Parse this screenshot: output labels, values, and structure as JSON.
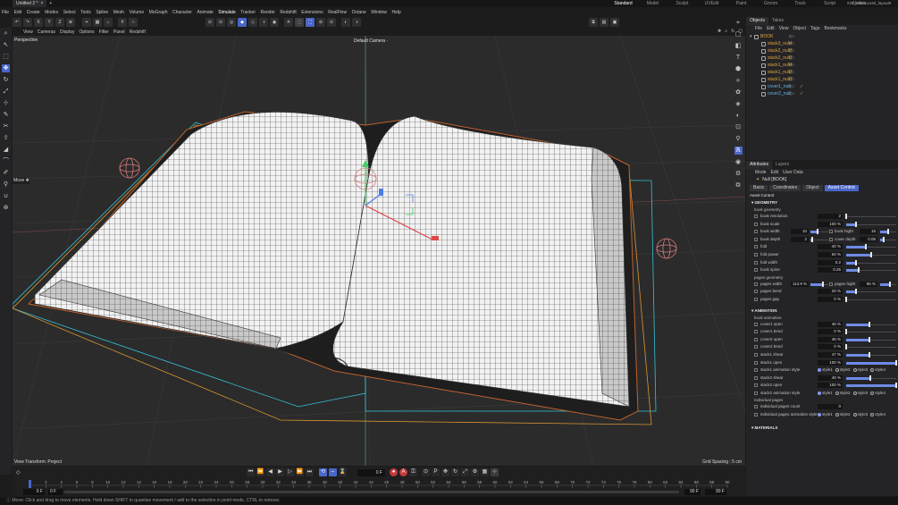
{
  "tabs": {
    "document": "Untitled 2 *",
    "layouts": [
      "Standard",
      "Model",
      "Sculpt",
      "UVEdit",
      "Paint",
      "Groom",
      "Track",
      "Script",
      "Nodes"
    ],
    "project": "#28_2560x1440_layout0"
  },
  "menu": [
    "File",
    "Edit",
    "Create",
    "Modes",
    "Select",
    "Tools",
    "Spline",
    "Mesh",
    "Volume",
    "MoGraph",
    "Character",
    "Animate",
    "Simulate",
    "Tracker",
    "Render",
    "Redshift",
    "Extensions",
    "RealFlow",
    "Octane",
    "Window",
    "Help"
  ],
  "toolbar": {
    "axis": [
      "X",
      "Y",
      "Z"
    ]
  },
  "viewport": {
    "menu": [
      "View",
      "Cameras",
      "Display",
      "Options",
      "Filter",
      "Panel",
      "Redshift"
    ],
    "label": "Perspective",
    "camera": "Default Camera",
    "camera_icon": "dot-icon",
    "transform": "View Transform: Project",
    "grid": "Grid Spacing : 5 cm",
    "tooltip": "Move"
  },
  "timeline": {
    "frame": "0 F",
    "start": "0 F",
    "start2": "0 F",
    "end": "90 F",
    "end2": "90 F",
    "ticks": [
      "0",
      "2",
      "4",
      "6",
      "8",
      "10",
      "12",
      "14",
      "16",
      "18",
      "20",
      "22",
      "24",
      "26",
      "28",
      "30",
      "32",
      "34",
      "36",
      "38",
      "40",
      "42",
      "44",
      "46",
      "48",
      "50",
      "52",
      "54",
      "56",
      "58",
      "60",
      "62",
      "64",
      "66",
      "68",
      "70",
      "72",
      "74",
      "76",
      "78",
      "80",
      "82",
      "84",
      "86",
      "88",
      "90"
    ]
  },
  "status": "Move: Click and drag to move elements. Hold down SHIFT to quantize movement / add to the selection in point mode, CTRL to remove.",
  "objects": {
    "tabs": [
      "Objects",
      "Takes"
    ],
    "menu": [
      "File",
      "Edit",
      "View",
      "Object",
      "Tags",
      "Bookmarks"
    ],
    "items": [
      {
        "name": "BOOK",
        "indent": 0,
        "cyan": false,
        "check": false
      },
      {
        "name": "stack3_null4",
        "indent": 1,
        "cyan": false,
        "check": false
      },
      {
        "name": "stack2_null3",
        "indent": 1,
        "cyan": false,
        "check": false
      },
      {
        "name": "stack2_null2",
        "indent": 1,
        "cyan": false,
        "check": false
      },
      {
        "name": "stack1_null4",
        "indent": 1,
        "cyan": false,
        "check": false
      },
      {
        "name": "stack1_null3",
        "indent": 1,
        "cyan": false,
        "check": false
      },
      {
        "name": "stack1_null2",
        "indent": 1,
        "cyan": false,
        "check": false
      },
      {
        "name": "cover1_null",
        "indent": 1,
        "cyan": true,
        "check": true
      },
      {
        "name": "cover2_null",
        "indent": 1,
        "cyan": true,
        "check": true
      }
    ]
  },
  "attributes": {
    "tabs": [
      "Attributes",
      "Layers"
    ],
    "menu": [
      "Mode",
      "Edit",
      "User Data"
    ],
    "title": "Null [BOOK]",
    "subtabs": [
      "Basic",
      "Coordinates",
      "Object",
      "Asset Control"
    ],
    "active_subtab": "Asset Control",
    "section": "Asset Control",
    "geometry": {
      "head": "GEOMETRY",
      "group": "book geometry",
      "rows": [
        {
          "label": "book resolution",
          "value": "2",
          "fill": 0
        },
        {
          "label": "book scale",
          "value": "100 %",
          "fill": 0.2
        }
      ],
      "pairs": [
        {
          "l1": "book width",
          "v1": "10",
          "f1": 0.4,
          "l2": "book hight",
          "v2": "15",
          "f2": 0.5
        },
        {
          "l1": "book depth",
          "v1": "2",
          "f1": 0.1,
          "l2": "cover depth",
          "v2": "0.05",
          "f2": 0.2
        }
      ],
      "rows2": [
        {
          "label": "fold",
          "value": "40 %",
          "fill": 0.4
        },
        {
          "label": "fold power",
          "value": "50 %",
          "fill": 0.5
        },
        {
          "label": "fold width",
          "value": "0.2",
          "fill": 0.2
        },
        {
          "label": "book spine",
          "value": "0.25",
          "fill": 0.25
        }
      ],
      "group2": "pages geometry",
      "pair2": {
        "l1": "pages width",
        "v1": "113.9 %",
        "f1": 0.7,
        "l2": "pages hight",
        "v2": "96 %",
        "f2": 0.6
      },
      "rows3": [
        {
          "label": "pages bend",
          "value": "20 %",
          "fill": 0.2
        },
        {
          "label": "pages gap",
          "value": "0 %",
          "fill": 0
        }
      ]
    },
    "animation": {
      "head": "ANIMATION",
      "group": "book animation",
      "rows": [
        {
          "label": "cover1 open",
          "value": "46 %",
          "fill": 0.46
        },
        {
          "label": "cover1 bend",
          "value": "0 %",
          "fill": 0
        },
        {
          "label": "cover2 open",
          "value": "46 %",
          "fill": 0.46
        },
        {
          "label": "cover2 bend",
          "value": "0 %",
          "fill": 0
        },
        {
          "label": "stack1 shear",
          "value": "47 %",
          "fill": 0.47
        },
        {
          "label": "stack1 open",
          "value": "100 %",
          "fill": 1
        }
      ],
      "style_label1": "stack1 animation style",
      "rows2": [
        {
          "label": "stack2 shear",
          "value": "48 %",
          "fill": 0.48
        },
        {
          "label": "stack2 open",
          "value": "100 %",
          "fill": 1
        }
      ],
      "style_label2": "stack2 animation style",
      "styles": [
        "style1",
        "style2",
        "style3",
        "style4"
      ],
      "group2": "individual pages",
      "count_label": "individual pages count",
      "count_value": "0",
      "style_label3": "individual pages animation style"
    },
    "materials": "MATERIALS"
  }
}
